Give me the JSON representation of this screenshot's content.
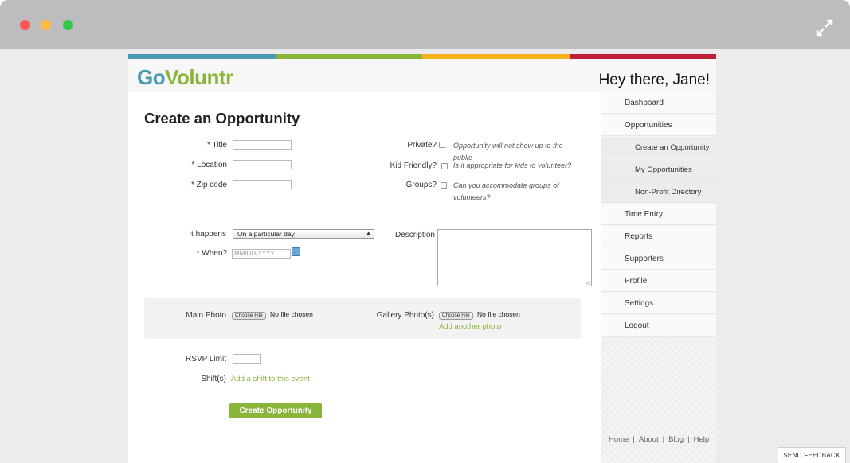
{
  "colors": {
    "bar": [
      "#4a9ab1",
      "#8ab53a",
      "#f5b21c",
      "#c0213a"
    ],
    "accent_green": "#8ab53a",
    "logo_blue": "#4a9ab1"
  },
  "header": {
    "logo_go": "Go",
    "logo_voluntr": "Voluntr",
    "greeting": "Hey there, Jane!"
  },
  "form": {
    "title": "Create an Opportunity",
    "title_label": "* Title",
    "location_label": "* Location",
    "zip_label": "* Zip code",
    "private_label": "Private?",
    "private_hint": "Opportunity will not show up to the public",
    "kid_label": "Kid Friendly?",
    "kid_hint": "Is it appropriate for kids to volunteer?",
    "groups_label": "Groups?",
    "groups_hint": "Can you accommodate groups of volunteers?",
    "happens_label": "It happens",
    "happens_value": "On a particular day",
    "when_label": "* When?",
    "when_placeholder": "MM/DD/YYYY",
    "description_label": "Description",
    "main_photo_label": "Main Photo",
    "gallery_label": "Gallery Photo(s)",
    "choose_file": "Choose File",
    "no_file": "No file chosen",
    "add_photo": "Add another photo",
    "rsvp_label": "RSVP Limit",
    "shifts_label": "Shift(s)",
    "add_shift": "Add a shift to this event",
    "submit": "Create Opportunity"
  },
  "sidebar": {
    "items": [
      {
        "label": "Dashboard"
      },
      {
        "label": "Opportunities"
      },
      {
        "label": "Create an Opportunity"
      },
      {
        "label": "My Opportunities"
      },
      {
        "label": "Non-Profit Directory"
      },
      {
        "label": "Time Entry"
      },
      {
        "label": "Reports"
      },
      {
        "label": "Supporters"
      },
      {
        "label": "Profile"
      },
      {
        "label": "Settings"
      },
      {
        "label": "Logout"
      }
    ],
    "footer": [
      "Home",
      "About",
      "Blog",
      "Help"
    ]
  },
  "feedback": "SEND FEEDBACK"
}
